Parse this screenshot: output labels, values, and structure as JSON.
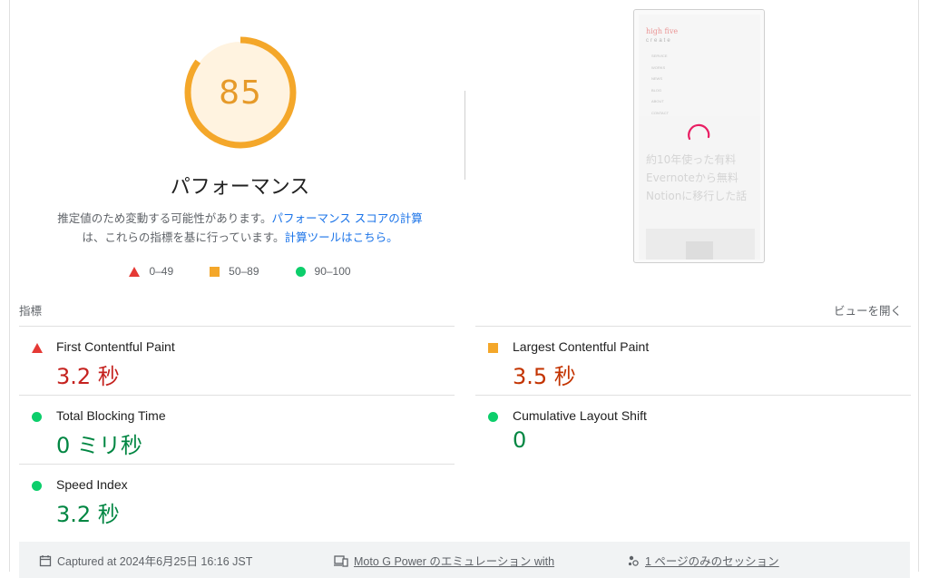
{
  "gauge": {
    "score": "85",
    "score_value": 0.85,
    "title": "パフォーマンス",
    "desc_text1": "推定値のため変動する可能性があります。",
    "desc_link1": "パフォーマンス スコアの計算",
    "desc_text2": "は、これらの指標を基に行っています。",
    "desc_link2": "計算ツールはこちら。",
    "color": "#f4a72a"
  },
  "legend": [
    {
      "icon": "red-triangle-icon",
      "label": "0–49"
    },
    {
      "icon": "orange-square-icon",
      "label": "50–89"
    },
    {
      "icon": "green-circle-icon",
      "label": "90–100"
    }
  ],
  "thumbnail": {
    "logo": "high five",
    "logo_sub": "create",
    "nav": [
      "SERVICE",
      "WORKS",
      "NEWS",
      "BLOG",
      "ABOUT",
      "CONTACT"
    ],
    "headline_lines": [
      "約10年使った有料",
      "Evernoteから無料",
      "Notionに移行した話"
    ]
  },
  "metrics": {
    "label": "指標",
    "open_view": "ビューを開く",
    "items": [
      {
        "name": "First Contentful Paint",
        "value": "3.2 秒",
        "rating": "red"
      },
      {
        "name": "Largest Contentful Paint",
        "value": "3.5 秒",
        "rating": "orange"
      },
      {
        "name": "Total Blocking Time",
        "value": "0 ミリ秒",
        "rating": "green"
      },
      {
        "name": "Cumulative Layout Shift",
        "value": "0",
        "rating": "green"
      },
      {
        "name": "Speed Index",
        "value": "3.2 秒",
        "rating": "green"
      }
    ]
  },
  "footer": {
    "captured": "Captured at 2024年6月25日 16:16 JST",
    "device": "Moto G Power のエミュレーション with",
    "session": "1 ページのみのセッション"
  }
}
